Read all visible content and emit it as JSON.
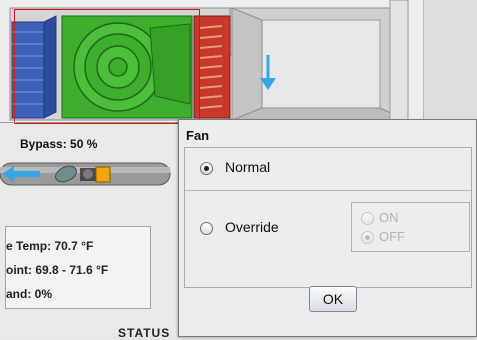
{
  "ahu": {
    "bypass_label": "Bypass: 50 %"
  },
  "temps": {
    "line1": "e Temp: 70.7 °F",
    "line2": "oint: 69.8 - 71.6 °F",
    "line3": "and: 0%"
  },
  "status_label": "STATUS",
  "dialog": {
    "title": "Fan",
    "normal_label": "Normal",
    "override_label": "Override",
    "on_label": "ON",
    "off_label": "OFF",
    "ok_label": "OK",
    "selected_mode": "Normal",
    "selected_override_state": "OFF"
  },
  "colors": {
    "fan_green": "#3fae2f",
    "filter_blue": "#3d60b8",
    "coil_red": "#c8382c",
    "frame_red": "#dd1111",
    "arrow_blue": "#35a5e6"
  }
}
